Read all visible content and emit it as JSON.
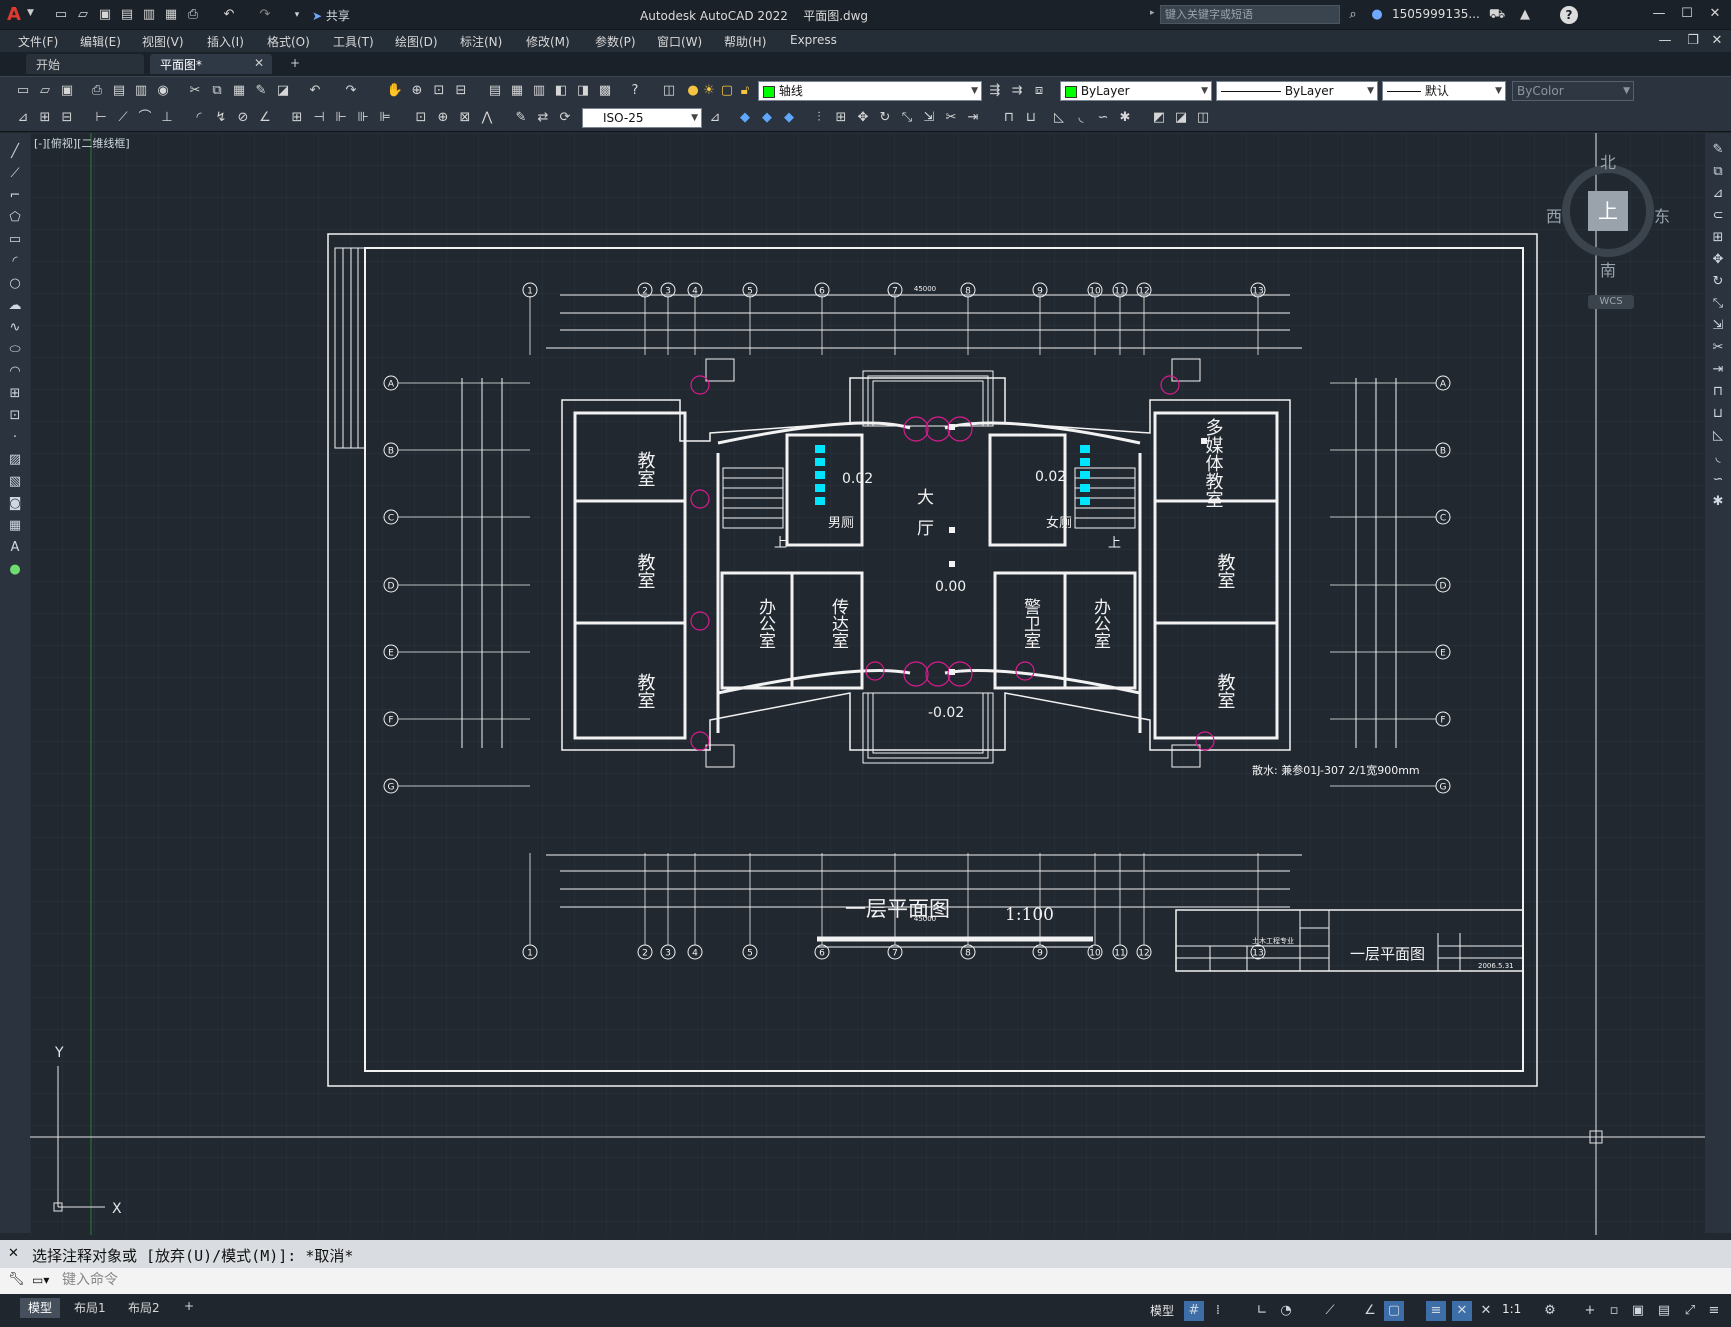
{
  "app": {
    "logo_letter": "A",
    "title": "Autodesk AutoCAD 2022",
    "file": "平面图.dwg",
    "share_label": "共享",
    "search_placeholder": "键入关键字或短语",
    "user": "1505999135...",
    "help": "?"
  },
  "menu": [
    "文件(F)",
    "编辑(E)",
    "视图(V)",
    "插入(I)",
    "格式(O)",
    "工具(T)",
    "绘图(D)",
    "标注(N)",
    "修改(M)",
    "参数(P)",
    "窗口(W)",
    "帮助(H)",
    "Express"
  ],
  "tabs": {
    "start": "开始",
    "drawing": "平面图*",
    "add": "+"
  },
  "toolbar": {
    "layer": "轴线",
    "color": "ByLayer",
    "linetype": "ByLayer",
    "lineweight": "默认",
    "plotstyle": "ByColor",
    "dimstyle": "ISO-25"
  },
  "viewport_label": "[-][俯视][二维线框]",
  "viewcube": {
    "north": "北",
    "south": "南",
    "west": "西",
    "east": "东",
    "top": "上",
    "wcs": "WCS"
  },
  "ucs": {
    "x": "X",
    "y": "Y"
  },
  "drawing": {
    "title": "一层平面图",
    "scale": "1:100",
    "axes_top": [
      "1",
      "2",
      "3",
      "4",
      "5",
      "6",
      "7",
      "8",
      "9",
      "10",
      "11",
      "12",
      "13"
    ],
    "axes_side": [
      "A",
      "B",
      "C",
      "D",
      "E",
      "F",
      "G"
    ],
    "overall_dim": "45000",
    "rooms": {
      "classroom": "教室",
      "multimedia": "多媒体教室",
      "hall": "大厅",
      "office": "办公室",
      "reception": "传达室",
      "guard": "警卫室",
      "men": "男厕",
      "women": "女厕",
      "up": "上"
    },
    "levels": {
      "hall": "0.00",
      "entry": "-0.02",
      "toilet": "0.02"
    },
    "note": "散水: 兼参01J-307 2/1宽900mm",
    "titleblock": {
      "sheet_title": "一层平面图",
      "major": "土木工程专业",
      "date": "2006.5.31"
    }
  },
  "command": {
    "history": "选择注释对象或 [放弃(U)/模式(M)]: *取消*",
    "placeholder": "键入命令"
  },
  "status": {
    "layouts": [
      "模型",
      "布局1",
      "布局2"
    ],
    "add": "+",
    "model_label": "模型",
    "scale": "1:1"
  }
}
